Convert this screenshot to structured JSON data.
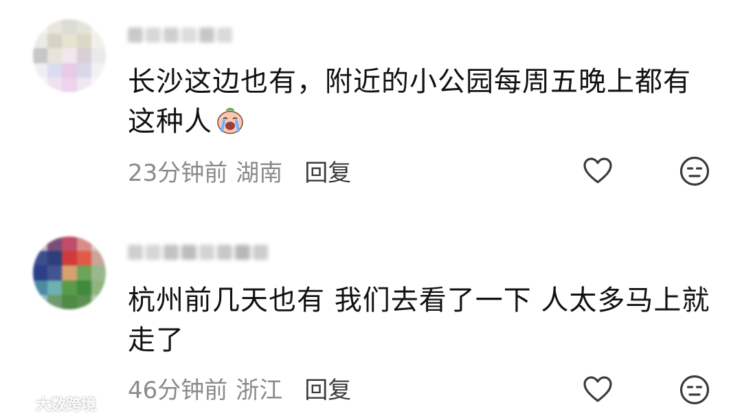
{
  "comments": [
    {
      "text": "长沙这边也有，附近的小公园每周五晚上都有这种人",
      "emoji": "crying-emoji",
      "time": "23分钟前",
      "region": "湖南",
      "reply_label": "回复"
    },
    {
      "text": "杭州前几天也有 我们去看了一下 人太多马上就走了",
      "time": "46分钟前",
      "region": "浙江",
      "reply_label": "回复"
    }
  ],
  "watermark": {
    "text": "大数跨境",
    "logo": "watermark-logo-icon"
  },
  "colors": {
    "text": "#111111",
    "meta": "#8a8a8a",
    "reply": "#3a3a3a",
    "icon": "#3a3a3a"
  }
}
